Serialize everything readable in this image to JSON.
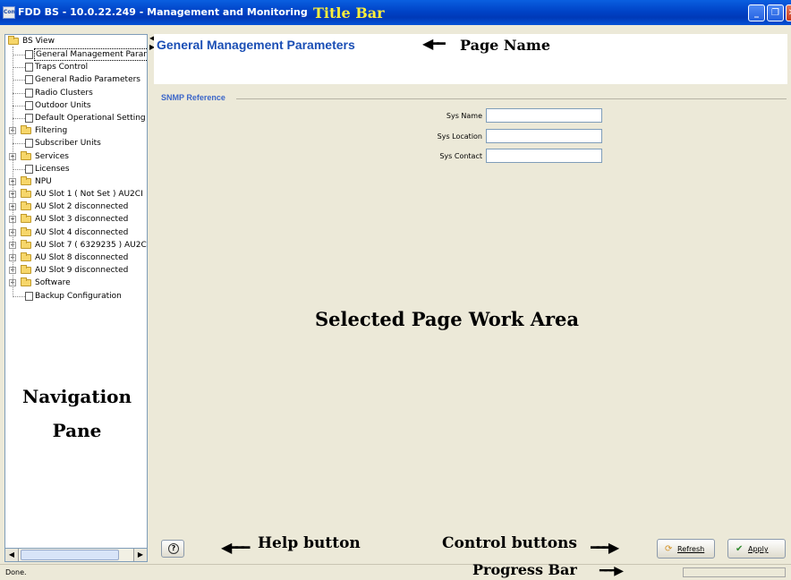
{
  "window": {
    "app_icon_text": "Con",
    "title": "FDD BS - 10.0.22.249 - Management and Monitoring",
    "minimize_glyph": "_",
    "maximize_glyph": "❐",
    "close_glyph": "✕"
  },
  "navigation": {
    "root_label": "BS View",
    "items": [
      {
        "label": "General Management Paran",
        "type": "page",
        "selected": true
      },
      {
        "label": "Traps Control",
        "type": "page"
      },
      {
        "label": "General Radio Parameters",
        "type": "page"
      },
      {
        "label": "Radio Clusters",
        "type": "page"
      },
      {
        "label": "Outdoor Units",
        "type": "page"
      },
      {
        "label": "Default Operational Setting",
        "type": "page"
      },
      {
        "label": "Filtering",
        "type": "folder"
      },
      {
        "label": "Subscriber Units",
        "type": "page"
      },
      {
        "label": "Services",
        "type": "folder"
      },
      {
        "label": "Licenses",
        "type": "page"
      },
      {
        "label": "NPU",
        "type": "folder"
      },
      {
        "label": "AU Slot 1 ( Not Set ) AU2CI",
        "type": "folder"
      },
      {
        "label": "AU Slot 2 disconnected",
        "type": "folder"
      },
      {
        "label": "AU Slot 3 disconnected",
        "type": "folder"
      },
      {
        "label": "AU Slot 4 disconnected",
        "type": "folder"
      },
      {
        "label": "AU Slot 7 ( 6329235 ) AU2C",
        "type": "folder"
      },
      {
        "label": "AU Slot 8 disconnected",
        "type": "folder"
      },
      {
        "label": "AU Slot 9 disconnected",
        "type": "folder"
      },
      {
        "label": "Software",
        "type": "folder"
      },
      {
        "label": "Backup Configuration",
        "type": "page"
      }
    ],
    "scroll_left": "◀",
    "scroll_right": "▶"
  },
  "page": {
    "title": "General Management Parameters",
    "group_title": "SNMP Reference",
    "fields": [
      {
        "label": "Sys Name",
        "value": ""
      },
      {
        "label": "Sys Location",
        "value": ""
      },
      {
        "label": "Sys Contact",
        "value": ""
      }
    ]
  },
  "buttons": {
    "help": "?",
    "refresh": "Refresh",
    "apply": "Apply"
  },
  "status": {
    "text": "Done."
  },
  "annotations": {
    "title_bar": "Title Bar",
    "page_name": "Page Name",
    "work_area": "Selected Page Work Area",
    "navigation_line1": "Navigation",
    "navigation_line2": "Pane",
    "help_button": "Help button",
    "control_buttons": "Control buttons",
    "progress_bar": "Progress Bar"
  }
}
